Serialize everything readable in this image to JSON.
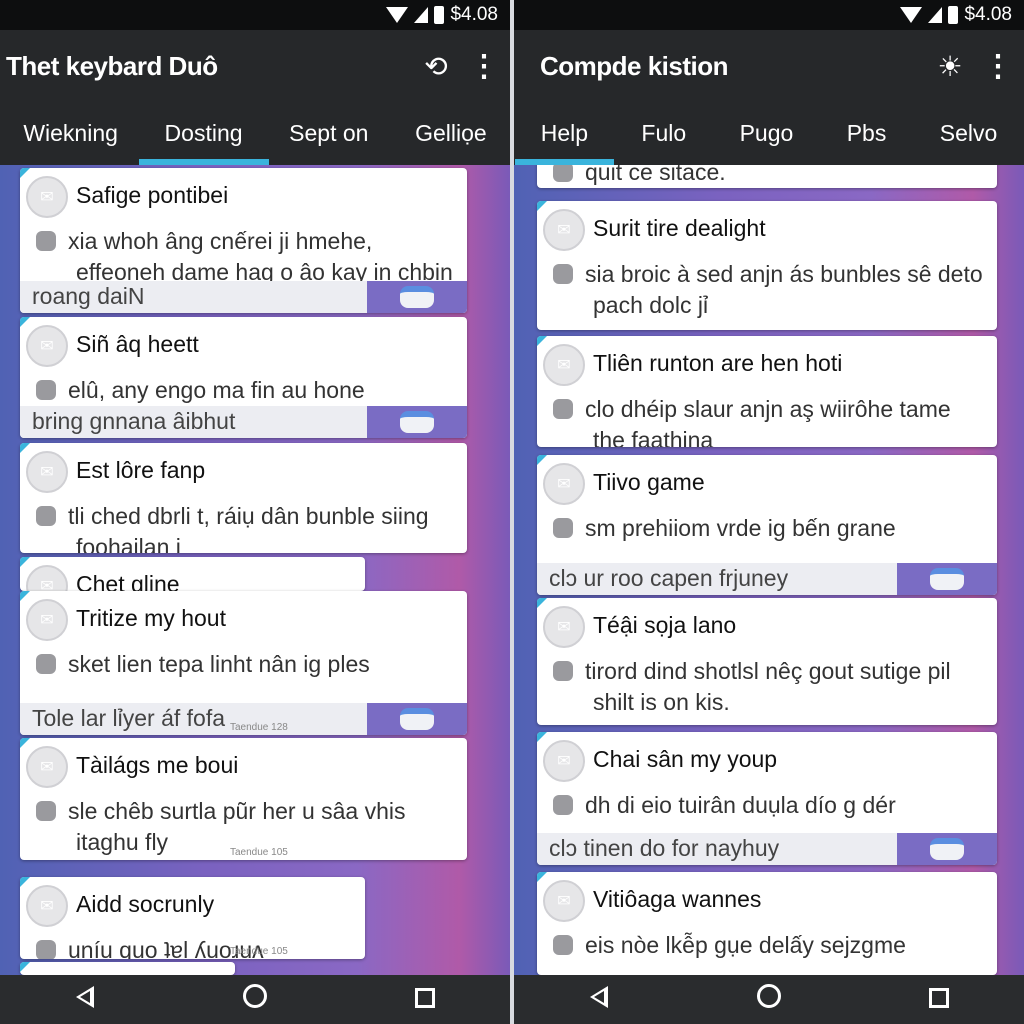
{
  "left": {
    "status_time": "$4.08",
    "title": "Thet keybard Duô",
    "toolbar_icons": [
      "rotate-icon",
      "more-vert-icon"
    ],
    "tabs": [
      {
        "label": "Wiekning"
      },
      {
        "label": "Dosting",
        "active": true
      },
      {
        "label": "Sept on"
      },
      {
        "label": "Gelliọe"
      }
    ],
    "cards": [
      {
        "title": "Safige pontibei",
        "body": "xia whoh âng cnếrei ji hmehe, effeoneh dame hag o âọ kay in chbin jỉ",
        "footer": "roang daiN"
      },
      {
        "title": "Siñ âq heett",
        "body": "elû, any engo ma fin au hone",
        "footer": "bring gnnana âibhut"
      },
      {
        "title": "Est lôre fanp",
        "body": "tli ched dbrli t, ráiụ dân bunble siing foohailan i"
      },
      {
        "title": "Chet gline"
      },
      {
        "title": "Tritize my hout",
        "body": "sket lien tepa linht nân ig ples",
        "footer": "Tole lar lỉyer áf fofa",
        "small": "Taendue 128"
      },
      {
        "title": "Tàilágs me boui",
        "body": "sle chêb surtla pũr her u sâa vhis itaghu fly",
        "small": "Taendue 105"
      },
      {
        "title": "Aidd socrunly",
        "body": "uníu quo ʇɐl ʎuoɹuʌ",
        "small": "Taendue 105"
      },
      {
        "title": ""
      }
    ]
  },
  "right": {
    "status_time": "$4.08",
    "title": "Compde kistion",
    "toolbar_icons": [
      "brightness-icon",
      "more-vert-icon"
    ],
    "tabs": [
      {
        "label": "Help",
        "active": true
      },
      {
        "label": "Fulo"
      },
      {
        "label": "Pugo"
      },
      {
        "label": "Pbs"
      },
      {
        "label": "Selvo"
      }
    ],
    "cards": [
      {
        "title": "",
        "body": "quit ce sitace."
      },
      {
        "title": "Surit tire dealight",
        "body": "sia broic à sed anjn ás bunbles sê deto pach dolc jỉ"
      },
      {
        "title": "Tliên runton are hen hoti",
        "body": "clo dhéip slaur anjn aş wiirôhe tame the faathina"
      },
      {
        "title": "Tiivo game",
        "body": "sm prehiiom vrde ig bến grane",
        "footer": "clɔ ur roo capen frjuney"
      },
      {
        "title": "Téậi sọja lano",
        "body": "tirord dind shotlsl nêç gout sutige pil shilt is on kis."
      },
      {
        "title": "Chai sân my youp",
        "body": "dh di eio tuirân duụla dío g dér",
        "footer": "clɔ tinen do for nayhuy"
      },
      {
        "title": "Vitiôaga wannes",
        "body": "eis nòe lkễp gụe delấy sejzgme"
      }
    ]
  },
  "colors": {
    "tab_indicator": "#3ab4dc",
    "toolbar": "#26282a",
    "status_bar": "#0d0e0f"
  },
  "nav_icons": [
    "back-icon",
    "home-icon",
    "recents-icon"
  ]
}
